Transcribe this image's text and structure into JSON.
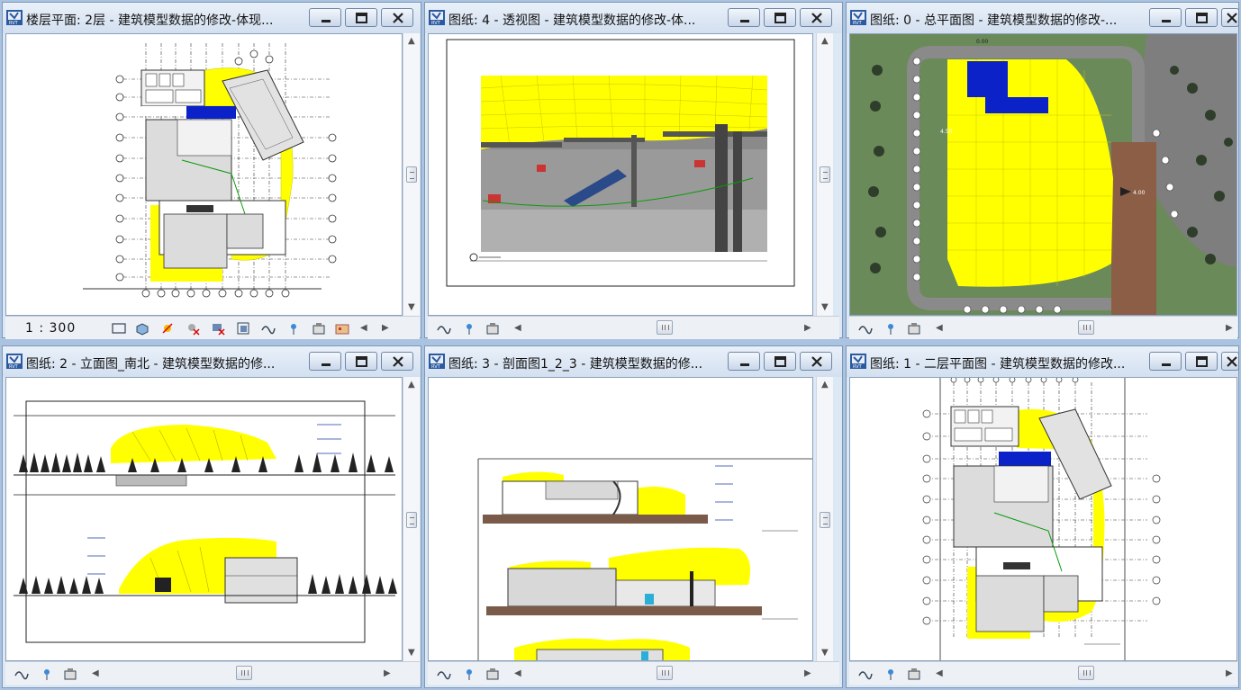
{
  "windows": [
    {
      "id": "w1",
      "title": "楼层平面: 2层 - 建筑模型数据的修改-体现...",
      "scale": "1 : 300"
    },
    {
      "id": "w2",
      "title": "图纸: 4 - 透视图 - 建筑模型数据的修改-体..."
    },
    {
      "id": "w3",
      "title": "图纸: 0 - 总平面图 - 建筑模型数据的修改-..."
    },
    {
      "id": "w4",
      "title": "图纸: 2 - 立面图_南北 - 建筑模型数据的修..."
    },
    {
      "id": "w5",
      "title": "图纸: 3 - 剖面图1_2_3 - 建筑模型数据的修..."
    },
    {
      "id": "w6",
      "title": "图纸: 1 - 二层平面图 - 建筑模型数据的修改..."
    }
  ],
  "icons": {
    "app": "revit-rvt-icon",
    "minimize": "minimize-icon",
    "maximize": "maximize-icon",
    "close": "close-icon",
    "view_toolbar": [
      "detail-level-icon",
      "visual-style-icon",
      "sun-path-icon",
      "shadows-icon",
      "crop-view-icon",
      "show-crop-icon",
      "temporary-hide-icon",
      "reveal-hidden-icon",
      "analytical-model-icon"
    ],
    "sheet_toolbar": [
      "steering-wheel-icon",
      "render-icon",
      "display-icon"
    ]
  },
  "colors": {
    "window_frame": "#dde8f5",
    "highlight_yellow": "#ffff00",
    "selection_blue": "#0a22c8",
    "site_green": "#6a8a5a",
    "terrain_brown": "#8b5e45"
  }
}
